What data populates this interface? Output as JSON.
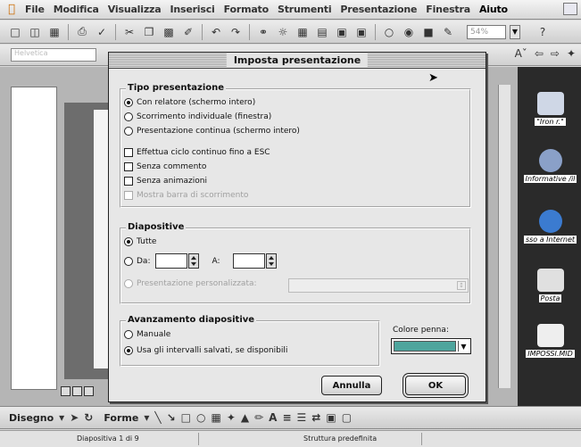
{
  "menubar": {
    "items": [
      "File",
      "Modifica",
      "Visualizza",
      "Inserisci",
      "Formato",
      "Strumenti",
      "Presentazione",
      "Finestra",
      "Aiuto"
    ],
    "active": "Aiuto"
  },
  "toolbar": {
    "zoom_value": "54%"
  },
  "fmtbar": {
    "font_value": "Helvetica"
  },
  "dialog": {
    "title": "Imposta presentazione",
    "tipo": {
      "title": "Tipo presentazione",
      "options": [
        "Con relatore (schermo intero)",
        "Scorrimento individuale (finestra)",
        "Presentazione continua (schermo intero)"
      ],
      "selected": 0,
      "checks": [
        {
          "label": "Effettua ciclo continuo fino a ESC",
          "checked": false,
          "disabled": false
        },
        {
          "label": "Senza commento",
          "checked": false,
          "disabled": false
        },
        {
          "label": "Senza animazioni",
          "checked": false,
          "disabled": false
        },
        {
          "label": "Mostra barra di scorrimento",
          "checked": false,
          "disabled": true
        }
      ]
    },
    "diapositive": {
      "title": "Diapositive",
      "all_label": "Tutte",
      "from_label": "Da:",
      "to_label": "A:",
      "custom_label": "Presentazione personalizzata:",
      "selected": "Tutte"
    },
    "avanzamento": {
      "title": "Avanzamento diapositive",
      "options": [
        "Manuale",
        "Usa gli intervalli salvati, se disponibili"
      ],
      "selected": 1
    },
    "pen_color": {
      "label": "Colore penna:",
      "color": "#4ea59d"
    },
    "buttons": {
      "cancel": "Annulla",
      "ok": "OK"
    }
  },
  "desktop": {
    "icons": [
      {
        "label": "\"Iron r.\"",
        "color": "#cfd7e6"
      },
      {
        "label": "Informative /il",
        "color": "#8aa0c8"
      },
      {
        "label": "sso a Internet",
        "color": "#3b7bd0"
      },
      {
        "label": "Posta",
        "color": "#e0e0e0"
      },
      {
        "label": "IMPOSSI.MID",
        "color": "#eeeeee"
      }
    ]
  },
  "drawbar": {
    "draw_label": "Disegno",
    "shapes_label": "Forme"
  },
  "statusbar": {
    "slide": "Diapositiva 1 di 9",
    "design": "Struttura predefinita"
  }
}
